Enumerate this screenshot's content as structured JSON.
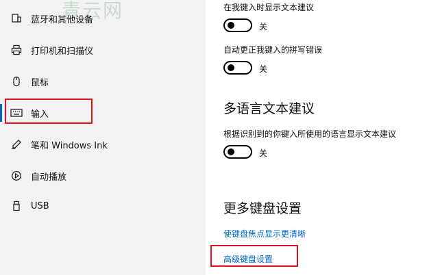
{
  "watermark": "青云网",
  "sidebar": {
    "items": [
      {
        "label": "蓝牙和其他设备",
        "icon": "bluetooth-devices-icon"
      },
      {
        "label": "打印机和扫描仪",
        "icon": "printer-icon"
      },
      {
        "label": "鼠标",
        "icon": "mouse-icon"
      },
      {
        "label": "输入",
        "icon": "keyboard-icon",
        "selected": true
      },
      {
        "label": "笔和 Windows Ink",
        "icon": "pen-icon"
      },
      {
        "label": "自动播放",
        "icon": "autoplay-icon"
      },
      {
        "label": "USB",
        "icon": "usb-icon"
      }
    ]
  },
  "main": {
    "show_suggestions_label": "在我键入时显示文本建议",
    "show_suggestions_state": "关",
    "autocorrect_label": "自动更正我键入的拼写错误",
    "autocorrect_state": "关",
    "multilingual_heading": "多语言文本建议",
    "multilingual_label": "根据识别到的你键入所使用的语言显示文本建议",
    "multilingual_state": "关",
    "more_keyboard_heading": "更多键盘设置",
    "focus_link": "使键盘焦点显示更清晰",
    "advanced_link": "高级键盘设置"
  },
  "colors": {
    "accent": "#0067c0",
    "highlight_box": "#e0141e",
    "sidebar_bg": "#f2f2f2"
  }
}
